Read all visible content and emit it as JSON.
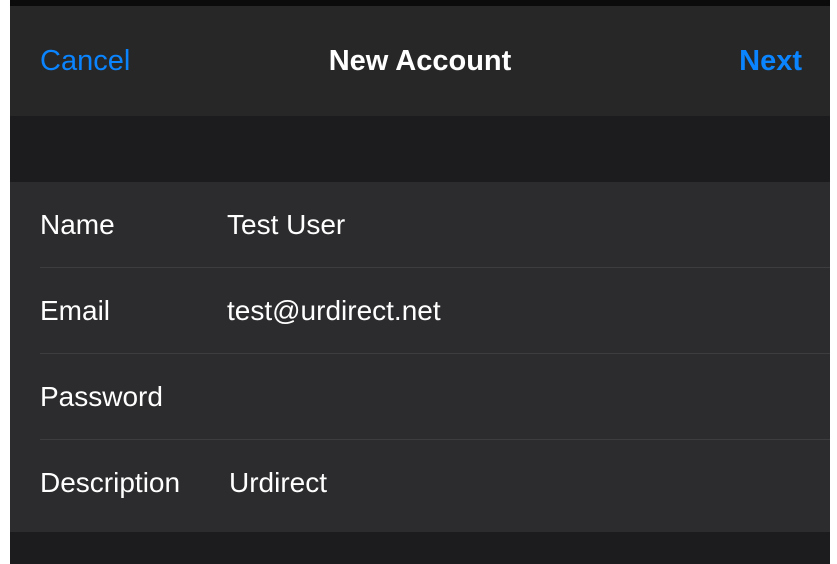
{
  "navbar": {
    "cancel_label": "Cancel",
    "title": "New Account",
    "next_label": "Next"
  },
  "form": {
    "fields": [
      {
        "label": "Name",
        "value": "Test User"
      },
      {
        "label": "Email",
        "value": "test@urdirect.net"
      },
      {
        "label": "Password",
        "value": ""
      },
      {
        "label": "Description",
        "value": "Urdirect"
      }
    ]
  },
  "colors": {
    "accent": "#0a84ff",
    "background": "#1c1c1e",
    "navbar": "#272727",
    "cell": "#2c2c2e",
    "text": "#ffffff"
  }
}
